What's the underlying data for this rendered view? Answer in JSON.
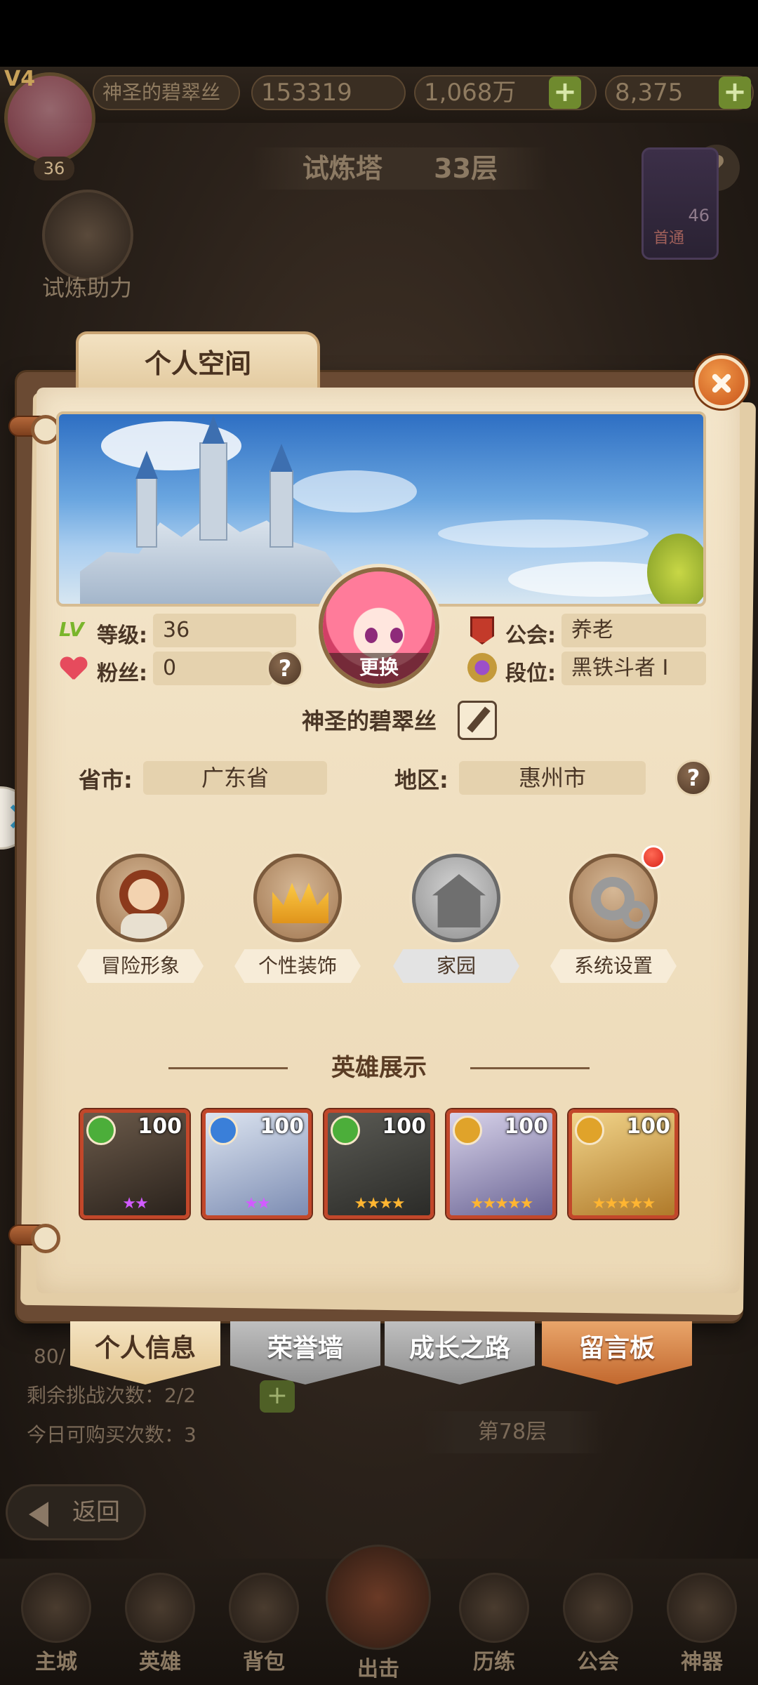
{
  "background": {
    "hud": {
      "vip": "V4",
      "player_level": "36",
      "player_name": "神圣的碧翠丝",
      "power": "153319",
      "gold": "1,068万",
      "gems": "8,375"
    },
    "tower_title": "试炼塔",
    "tower_floor": "33层",
    "help_power_label": "试炼助力",
    "first_clear_label": "首通",
    "first_clear_level": "46",
    "progress_text": "80/",
    "remaining_challenges": "剩余挑战次数：2/2",
    "daily_purchases": "今日可购买次数：3",
    "floor_label": "第78层",
    "back_label": "返回",
    "nav": [
      "主城",
      "英雄",
      "背包",
      "出击",
      "历练",
      "公会",
      "神器"
    ]
  },
  "modal": {
    "title": "个人空间",
    "avatar_change_label": "更换",
    "fields": {
      "level_label": "等级:",
      "level_value": "36",
      "fans_label": "粉丝:",
      "fans_value": "0",
      "guild_label": "公会:",
      "guild_value": "养老",
      "rank_label": "段位:",
      "rank_value": "黑铁斗者 I"
    },
    "player_name": "神圣的碧翠丝",
    "province_label": "省市:",
    "province_value": "广东省",
    "region_label": "地区:",
    "region_value": "惠州市",
    "features": [
      {
        "label": "冒险形象",
        "icon": "adventurer-icon"
      },
      {
        "label": "个性装饰",
        "icon": "crown-icon"
      },
      {
        "label": "家园",
        "icon": "house-icon",
        "disabled": true
      },
      {
        "label": "系统设置",
        "icon": "gear-icon",
        "notification": true
      }
    ],
    "hero_section_title": "英雄展示",
    "heroes": [
      {
        "level": "100",
        "element": "wind",
        "stars": "★★",
        "star_color": "#d25bff",
        "palette": [
          "#6b5a4a",
          "#2a221c"
        ]
      },
      {
        "level": "100",
        "element": "water",
        "stars": "★★",
        "star_color": "#d25bff",
        "palette": [
          "#dce4f0",
          "#7d8db3"
        ]
      },
      {
        "level": "100",
        "element": "wind",
        "stars": "★★★★",
        "star_color": "#ffb531",
        "palette": [
          "#5a5a54",
          "#2b2b28"
        ]
      },
      {
        "level": "100",
        "element": "light",
        "stars": "★★★★★",
        "star_color": "#ffb531",
        "palette": [
          "#d8d3ea",
          "#6a6494"
        ]
      },
      {
        "level": "100",
        "element": "light",
        "stars": "★★★★★",
        "star_color": "#ffb531",
        "palette": [
          "#f1d48a",
          "#b07a2a"
        ]
      }
    ],
    "tabs": [
      "个人信息",
      "荣誉墙",
      "成长之路",
      "留言板"
    ]
  },
  "colors": {
    "paper": "#f4e6cb",
    "accent_orange": "#c9541a",
    "text_brown": "#4a3626"
  }
}
